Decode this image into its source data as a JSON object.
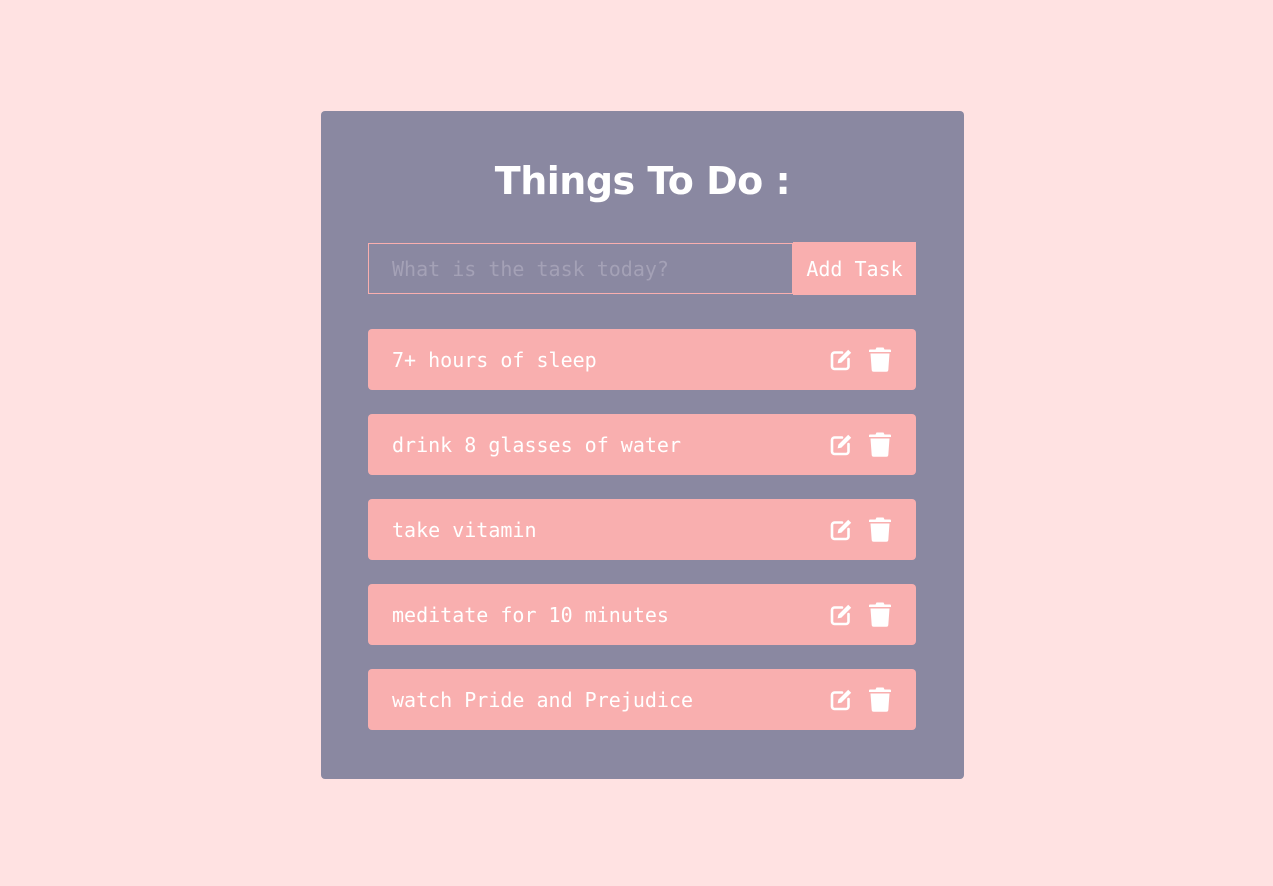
{
  "app": {
    "title": "Things To Do :"
  },
  "form": {
    "input_value": "",
    "input_placeholder": "What is the task today?",
    "add_label": "Add Task"
  },
  "tasks": [
    {
      "text": "7+ hours of sleep",
      "edit_icon": "edit-icon",
      "delete_icon": "trash-icon"
    },
    {
      "text": "drink 8 glasses of water",
      "edit_icon": "edit-icon",
      "delete_icon": "trash-icon"
    },
    {
      "text": "take vitamin",
      "edit_icon": "edit-icon",
      "delete_icon": "trash-icon"
    },
    {
      "text": "meditate for 10 minutes",
      "edit_icon": "edit-icon",
      "delete_icon": "trash-icon"
    },
    {
      "text": "watch Pride and Prejudice",
      "edit_icon": "edit-icon",
      "delete_icon": "trash-icon"
    }
  ],
  "colors": {
    "page_background": "#FFE2E2",
    "card_background": "#8A88A1",
    "accent": "#F9AFAF",
    "text": "#FFFFFF",
    "placeholder": "#A4A1B6"
  }
}
